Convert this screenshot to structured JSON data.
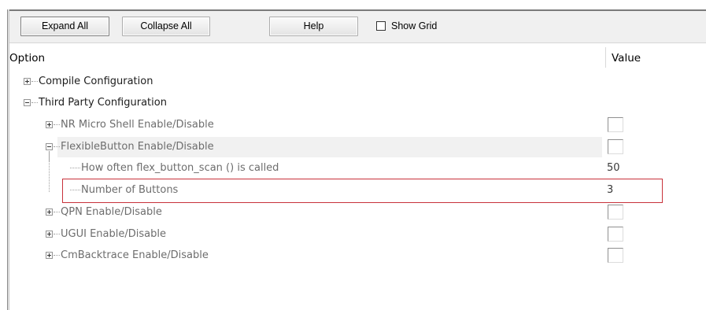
{
  "toolbar": {
    "expand_all": "Expand All",
    "collapse_all": "Collapse All",
    "help": "Help",
    "show_grid": "Show Grid"
  },
  "columns": {
    "option": "Option",
    "value": "Value"
  },
  "tree": {
    "compile_configuration": "Compile Configuration",
    "third_party_configuration": "Third Party Configuration",
    "nr_micro_shell": {
      "label": "NR Micro Shell Enable/Disable",
      "checked": false
    },
    "flexible_button": {
      "label": "FlexibleButton Enable/Disable",
      "checked": false
    },
    "scan_interval": {
      "label": "How often flex_button_scan () is called",
      "value": "50"
    },
    "number_of_buttons": {
      "label": "Number of Buttons",
      "value": "3"
    },
    "qpn": {
      "label": "QPN Enable/Disable",
      "checked": false
    },
    "ugui": {
      "label": "UGUI Enable/Disable",
      "checked": false
    },
    "cmbacktrace": {
      "label": "CmBacktrace Enable/Disable",
      "checked": false
    }
  },
  "colors": {
    "selection_border": "#c8323a",
    "row_highlight": "#f1f1f1"
  }
}
